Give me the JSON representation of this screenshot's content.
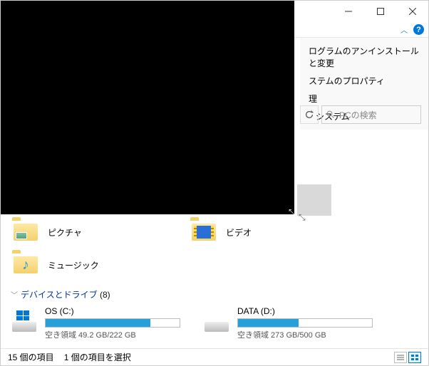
{
  "window": {
    "help": "?"
  },
  "sysmenu": {
    "uninstall": "ログラムのアンインストールと変更",
    "sys_props": "ステムのプロパティ",
    "manage": "理",
    "system": "システム"
  },
  "search": {
    "placeholder": "PCの検索"
  },
  "folders": {
    "pictures": "ピクチャ",
    "videos": "ビデオ",
    "music": "ミュージック"
  },
  "section": {
    "title": "デバイスとドライブ",
    "count": "(8)"
  },
  "drives": [
    {
      "name": "OS (C:)",
      "free": "空き領域 49.2 GB/222 GB",
      "fill_pct": 78
    },
    {
      "name": "DATA (D:)",
      "free": "空き領域 273 GB/500 GB",
      "fill_pct": 45
    }
  ],
  "status": {
    "items": "15 個の項目",
    "selected": "1 個の項目を選択"
  }
}
